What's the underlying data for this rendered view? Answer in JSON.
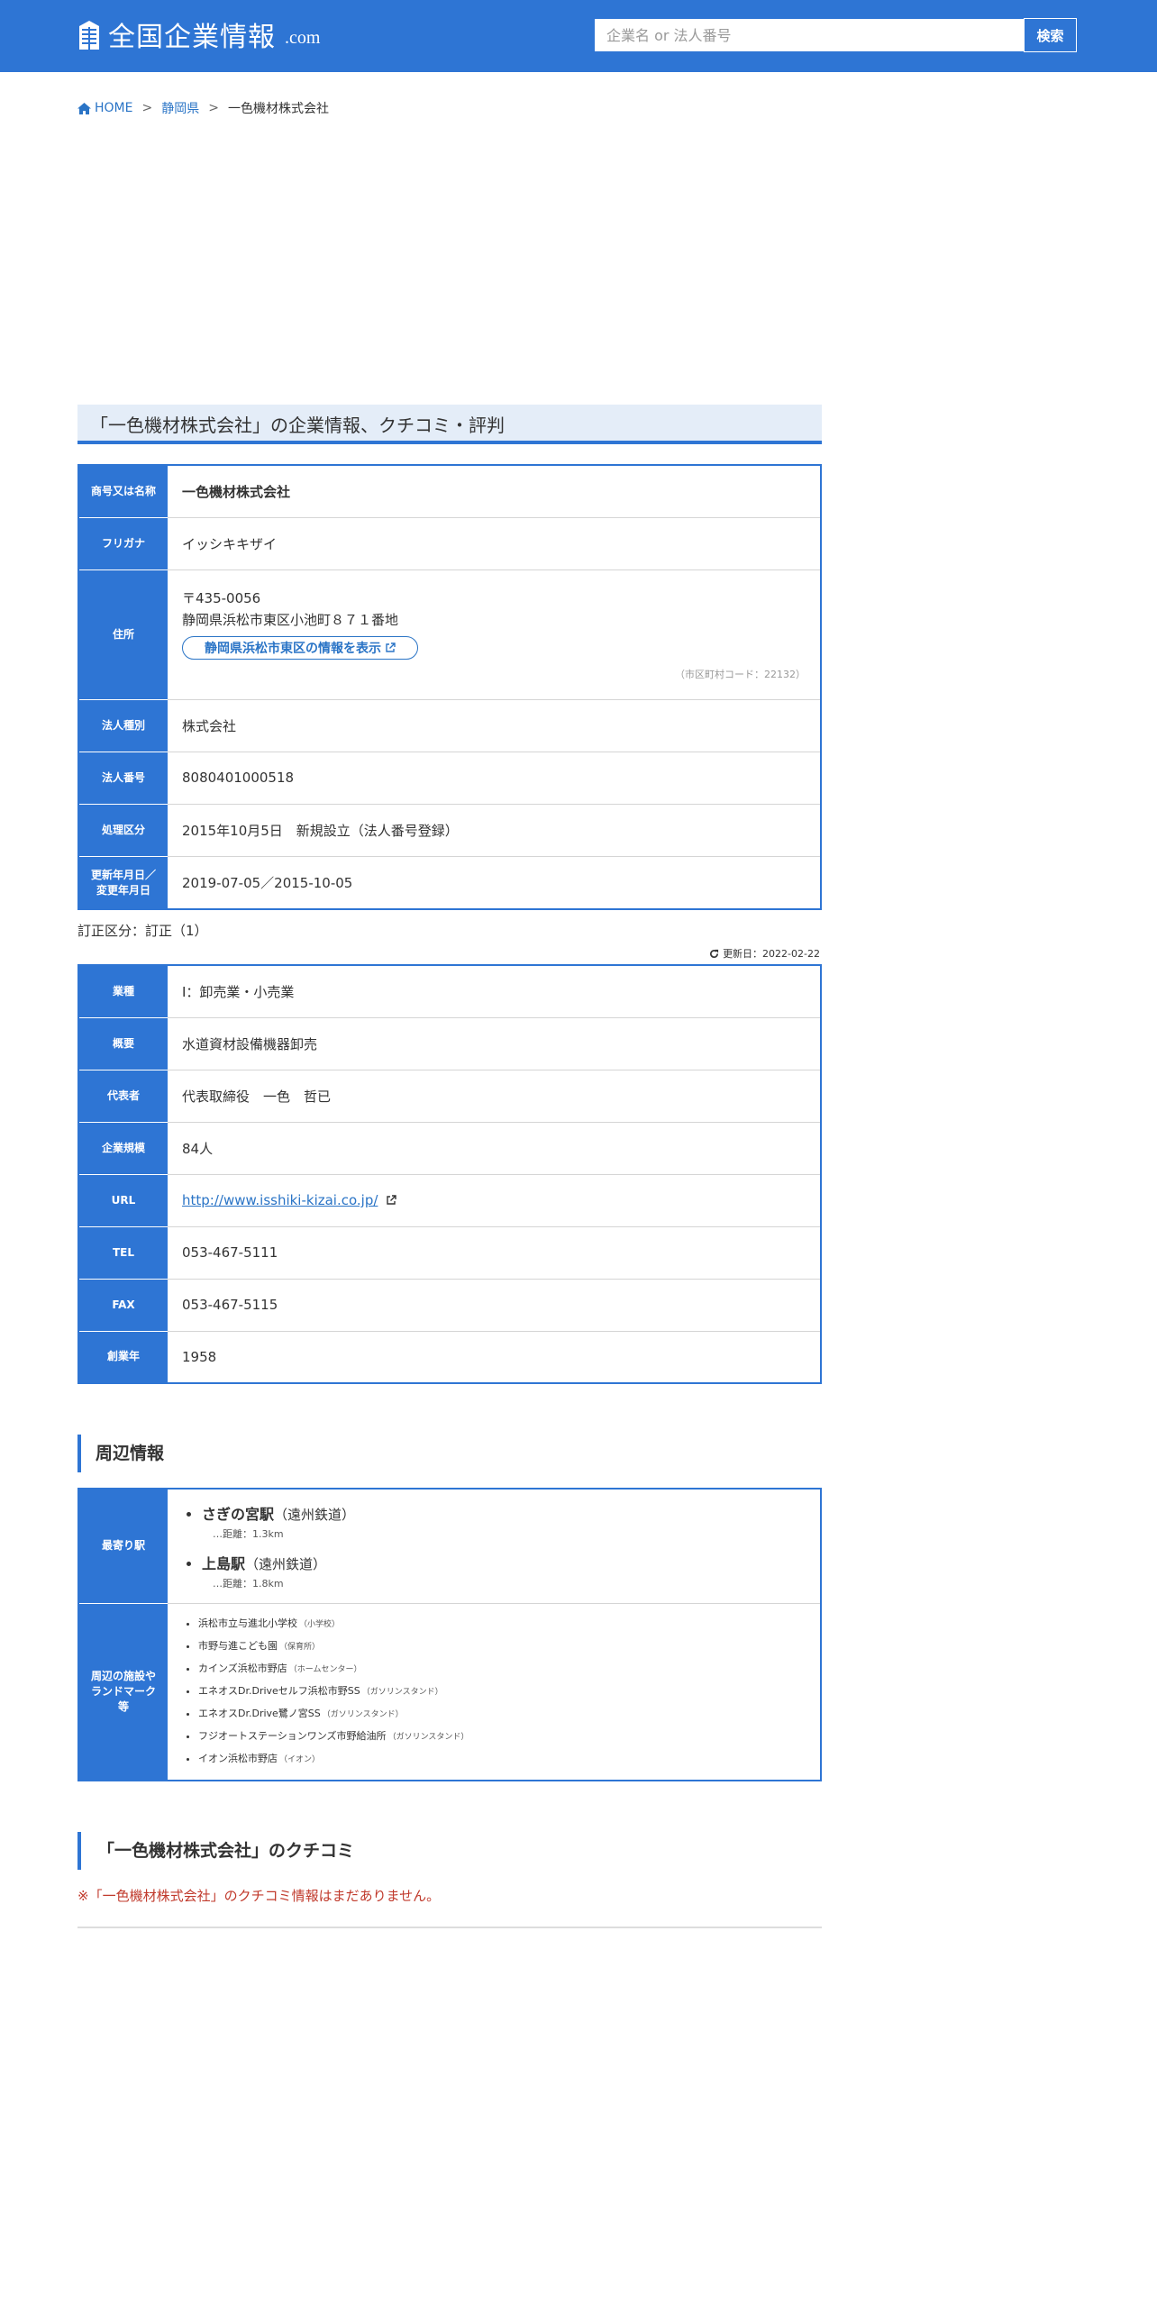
{
  "header": {
    "logo_text": "全国企業情報",
    "logo_suffix": ".com",
    "search_placeholder": "企業名 or 法人番号",
    "search_button": "検索",
    "brand_color": "#2e75d4"
  },
  "breadcrumb": {
    "home": "HOME",
    "prefecture": "静岡県",
    "current": "一色機材株式会社",
    "separator": ">"
  },
  "page_title": "「一色機材株式会社」の企業情報、クチコミ・評判",
  "registry": {
    "name_label": "商号又は名称",
    "name_value": "一色機材株式会社",
    "kana_label": "フリガナ",
    "kana_value": "イッシキキザイ",
    "address_label": "住所",
    "zip": "〒435-0056",
    "address": "静岡県浜松市東区小池町８７１番地",
    "area_link": "静岡県浜松市東区の情報を表示",
    "municipality_code": "（市区町村コード：22132）",
    "type_label": "法人種別",
    "type_value": "株式会社",
    "number_label": "法人番号",
    "number_value": "8080401000518",
    "process_label": "処理区分",
    "process_value": "2015年10月5日　新規設立（法人番号登録）",
    "updated_label_1": "更新年月日／",
    "updated_label_2": "変更年月日",
    "updated_value": "2019-07-05／2015-10-05"
  },
  "correction": "訂正区分：訂正（1）",
  "updated_date": "更新日：2022-02-22",
  "details": {
    "industry_label": "業種",
    "industry_value": "I：卸売業・小売業",
    "summary_label": "概要",
    "summary_value": "水道資材設備機器卸売",
    "rep_label": "代表者",
    "rep_value": "代表取締役　一色　哲已",
    "size_label": "企業規模",
    "size_value": "84人",
    "url_label": "URL",
    "url_value": "http://www.isshiki-kizai.co.jp/",
    "tel_label": "TEL",
    "tel_value": "053-467-5111",
    "fax_label": "FAX",
    "fax_value": "053-467-5115",
    "founded_label": "創業年",
    "founded_value": "1958"
  },
  "nearby": {
    "heading": "周辺情報",
    "station_label": "最寄り駅",
    "stations": [
      {
        "name": "さぎの宮駅",
        "line": "（遠州鉄道）",
        "distance": "…距離：1.3km"
      },
      {
        "name": "上島駅",
        "line": "（遠州鉄道）",
        "distance": "…距離：1.8km"
      }
    ],
    "landmark_label_1": "周辺の施設や",
    "landmark_label_2": "ランドマーク",
    "landmark_label_3": "等",
    "landmarks": [
      {
        "name": "浜松市立与進北小学校",
        "category": "（小学校）"
      },
      {
        "name": "市野与進こども園",
        "category": "（保育所）"
      },
      {
        "name": "カインズ浜松市野店",
        "category": "（ホームセンター）"
      },
      {
        "name": "エネオスDr.Driveセルフ浜松市野SS",
        "category": "（ガソリンスタンド）"
      },
      {
        "name": "エネオスDr.Drive鷺ノ宮SS",
        "category": "（ガソリンスタンド）"
      },
      {
        "name": "フジオートステーションワンズ市野給油所",
        "category": "（ガソリンスタンド）"
      },
      {
        "name": "イオン浜松市野店",
        "category": "（イオン）"
      }
    ]
  },
  "reviews": {
    "heading": "「一色機材株式会社」のクチコミ",
    "empty_message": "※「一色機材株式会社」のクチコミ情報はまだありません。"
  }
}
